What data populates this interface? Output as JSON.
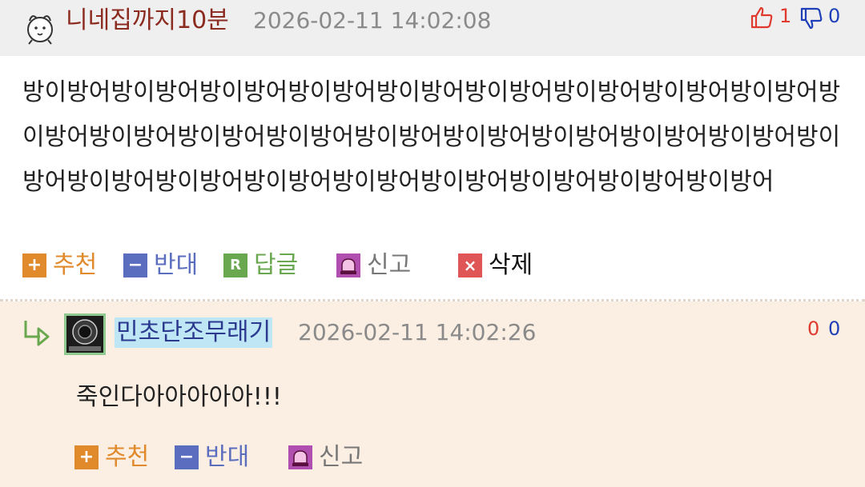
{
  "comment": {
    "author": "니네집까지10분",
    "timestamp": "2026-02-11 14:02:08",
    "upvotes": "1",
    "downvotes": "0",
    "body": "방이방어방이방어방이방어방이방어방이방어방이방어방이방어방이방어방이방어방이방어방이방어방이방어방이방어방이방어방이방어방이방어방이방어방이방어방이방어방이방어방이방어방이방어방이방어방이방어방이방어방이방어방이방어",
    "actions": {
      "recommend": "추천",
      "oppose": "반대",
      "reply": "답글",
      "report": "신고",
      "delete": "삭제"
    }
  },
  "reply": {
    "author": "민초단조무래기",
    "timestamp": "2026-02-11 14:02:26",
    "upvotes": "0",
    "downvotes": "0",
    "body": "죽인다아아아아아!!!",
    "actions": {
      "recommend": "추천",
      "oppose": "반대",
      "report": "신고"
    }
  },
  "colors": {
    "recommend": "#e08a2c",
    "oppose": "#5b6dbf",
    "reply": "#6aa84f",
    "report": "#b14fb1",
    "delete": "#e05555",
    "up": "#e03a2f",
    "down": "#1f3fb8"
  }
}
